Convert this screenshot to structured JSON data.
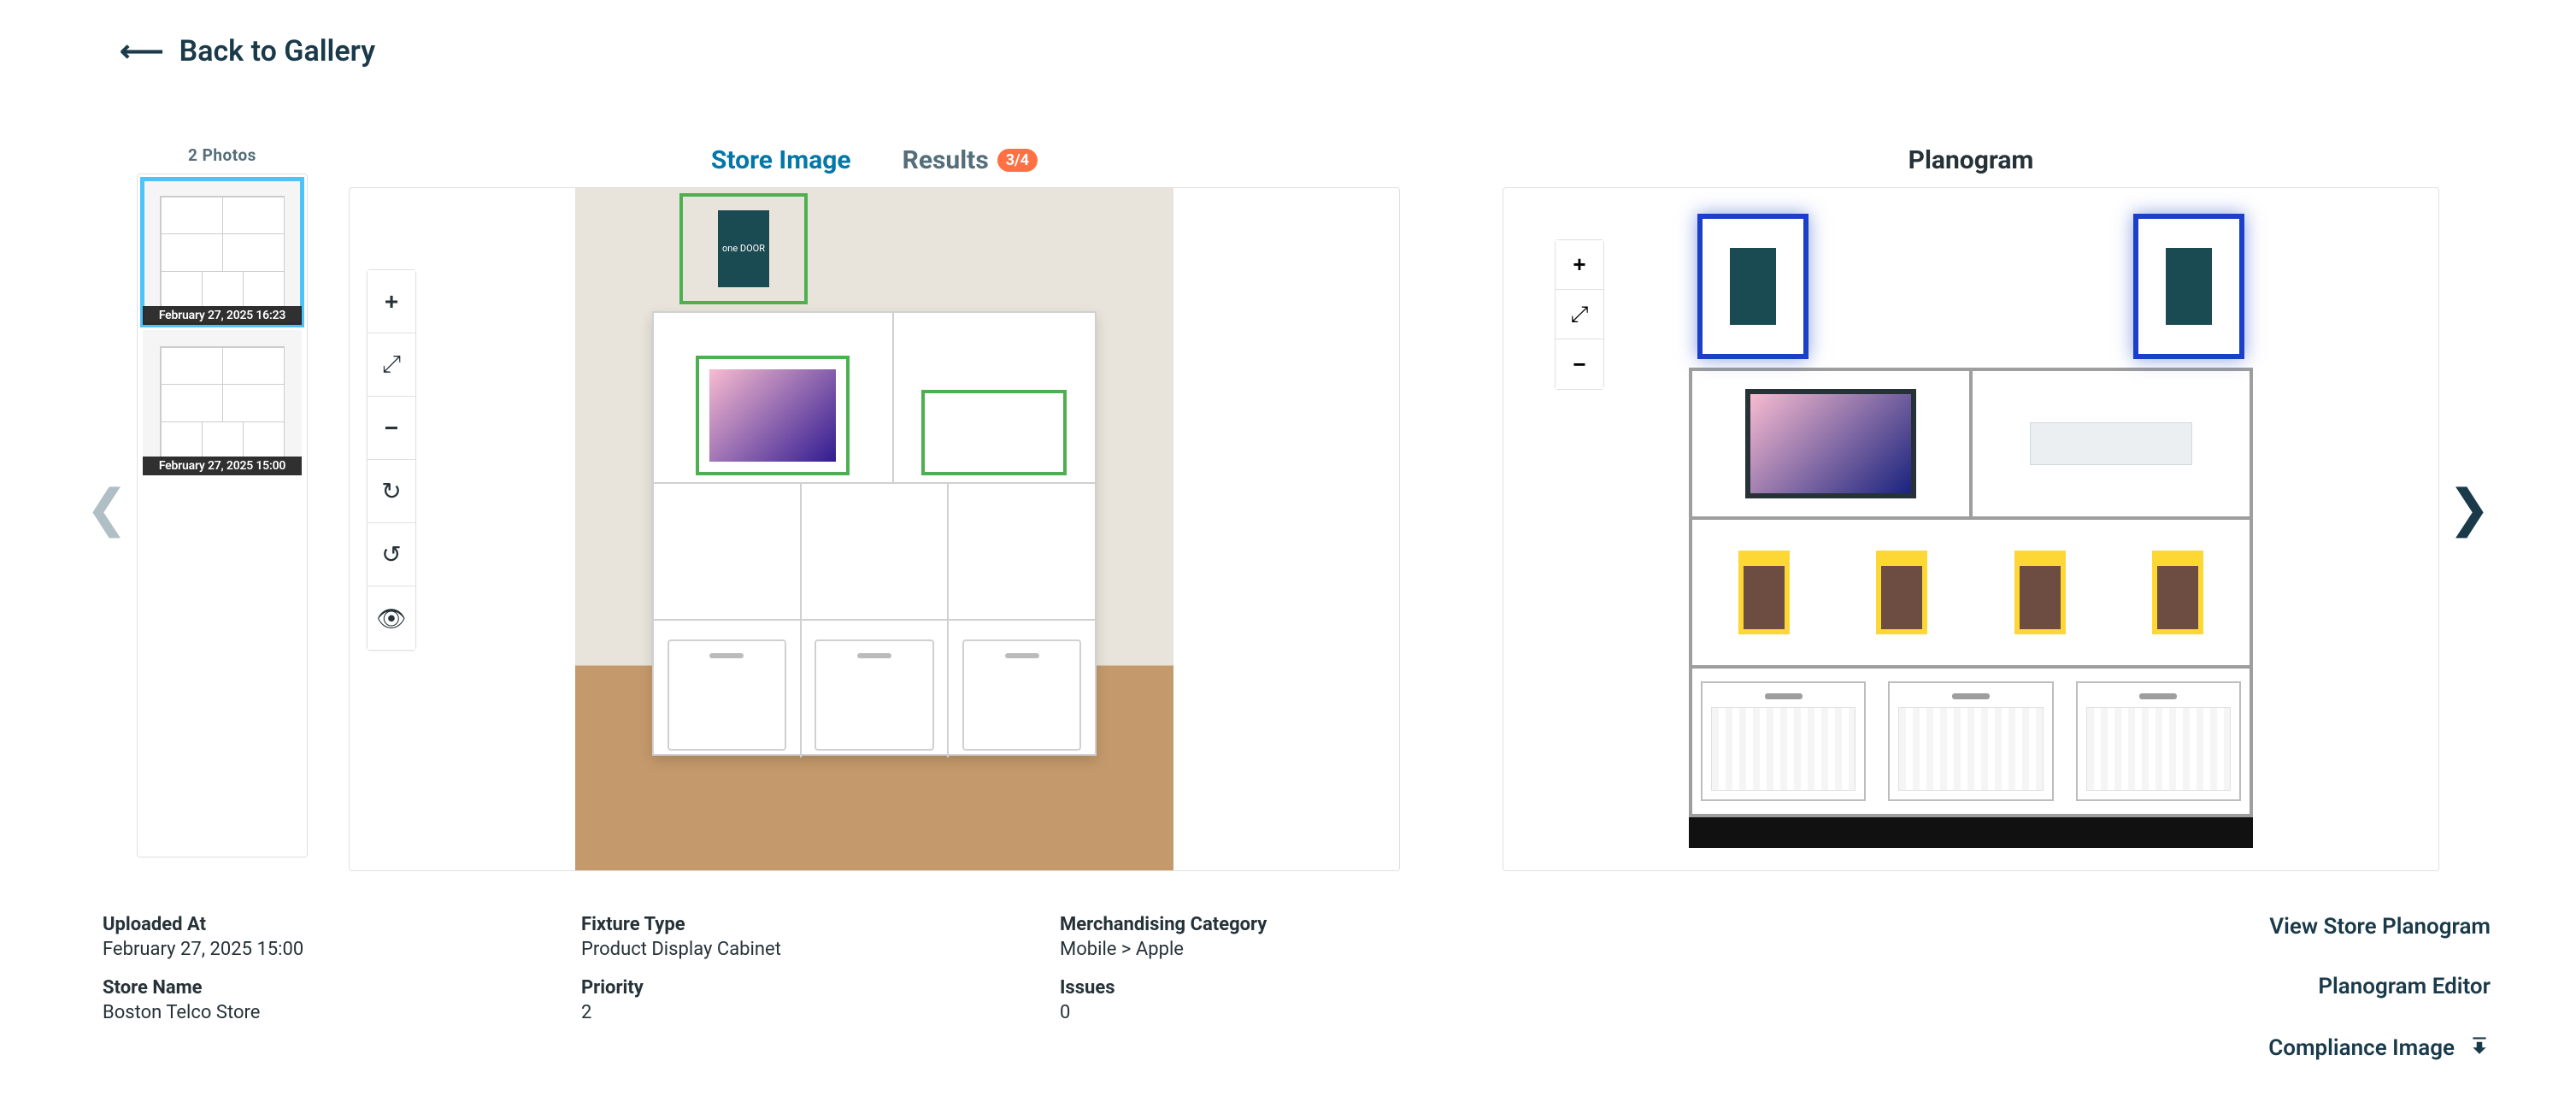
{
  "back_label": "Back to Gallery",
  "photos_header": "2 Photos",
  "thumbs": [
    {
      "time": "February 27, 2025 16:23"
    },
    {
      "time": "February 27, 2025 15:00"
    }
  ],
  "tabs": {
    "store_image": "Store Image",
    "results": "Results",
    "results_badge": "3/4"
  },
  "planogram_title": "Planogram",
  "sign_text": "one DOOR",
  "details": {
    "uploaded_at_label": "Uploaded At",
    "uploaded_at_value": "February 27, 2025 15:00",
    "store_name_label": "Store Name",
    "store_name_value": "Boston Telco Store",
    "fixture_type_label": "Fixture Type",
    "fixture_type_value": "Product Display Cabinet",
    "priority_label": "Priority",
    "priority_value": "2",
    "merch_cat_label": "Merchandising Category",
    "merch_cat_value": "Mobile > Apple",
    "issues_label": "Issues",
    "issues_value": "0"
  },
  "actions": {
    "view_store_planogram": "View Store Planogram",
    "planogram_editor": "Planogram Editor",
    "compliance_image": "Compliance Image"
  }
}
